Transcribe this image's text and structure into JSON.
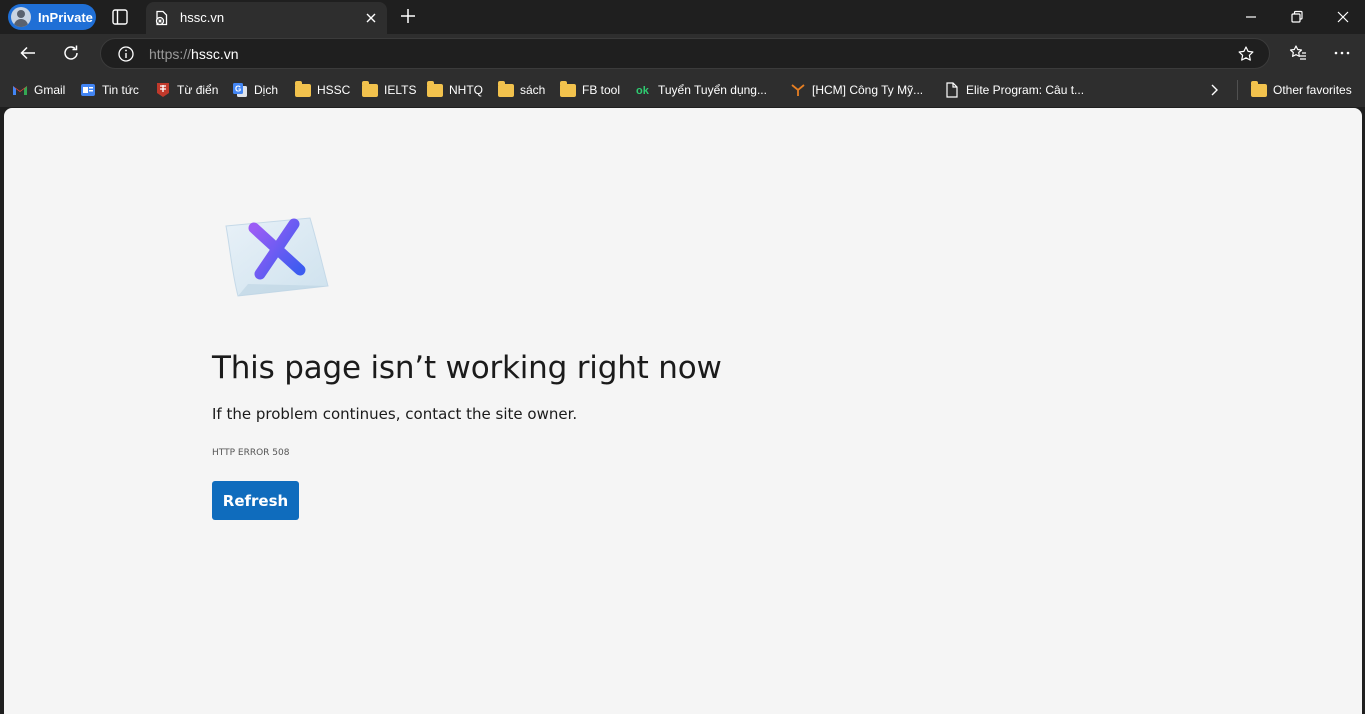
{
  "browser": {
    "inprivate_label": "InPrivate",
    "tab": {
      "title": "hssc.vn"
    },
    "address": {
      "scheme": "https://",
      "host": "hssc.vn"
    }
  },
  "favorites": [
    {
      "label": "Gmail",
      "icon": "gmail-icon"
    },
    {
      "label": "Tin tức",
      "icon": "google-news-icon"
    },
    {
      "label": "Từ điển",
      "icon": "dictionary-icon"
    },
    {
      "label": "Dịch",
      "icon": "google-translate-icon"
    },
    {
      "label": "HSSC",
      "icon": "folder-icon"
    },
    {
      "label": "IELTS",
      "icon": "folder-icon"
    },
    {
      "label": "NHTQ",
      "icon": "folder-icon"
    },
    {
      "label": "sách",
      "icon": "folder-icon"
    },
    {
      "label": "FB tool",
      "icon": "folder-icon"
    },
    {
      "label": "Tuyển Tuyển dụng...",
      "icon": "ok-icon"
    },
    {
      "label": "[HCM] Công Ty Mỹ...",
      "icon": "job-site-icon"
    },
    {
      "label": "Elite Program: Câu t...",
      "icon": "document-icon"
    }
  ],
  "other_favorites_label": "Other favorites",
  "error": {
    "title": "This page isn’t working right now",
    "subtitle": "If the problem continues, contact the site owner.",
    "code": "HTTP ERROR 508",
    "refresh_label": "Refresh"
  },
  "colors": {
    "accent": "#0f6cbd",
    "inprivate": "#1f6fd6",
    "chrome_dark": "#1f1f1f",
    "chrome_toolbar": "#2e2e2e",
    "page_bg": "#f5f5f5"
  }
}
